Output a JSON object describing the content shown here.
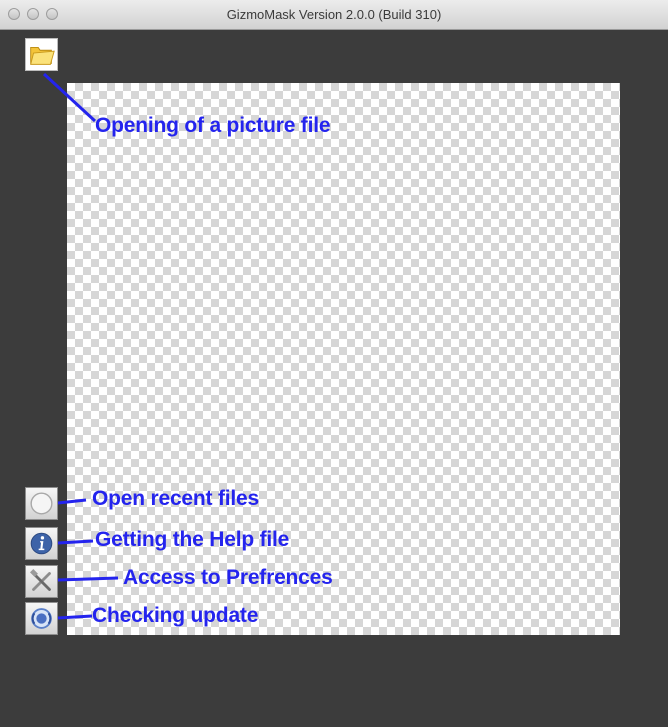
{
  "window": {
    "title": "GizmoMask Version 2.0.0 (Build 310)"
  },
  "toolbar": {
    "items": [
      {
        "id": "open",
        "icon": "folder-icon"
      },
      {
        "id": "recent",
        "icon": "clock-icon"
      },
      {
        "id": "help",
        "icon": "info-icon"
      },
      {
        "id": "preferences",
        "icon": "tools-icon"
      },
      {
        "id": "update",
        "icon": "update-icon"
      }
    ]
  },
  "annotations": {
    "open": "Opening of a picture file",
    "recent": "Open recent files",
    "help": "Getting the Help file",
    "preferences": "Access to Prefrences",
    "update": "Checking update"
  },
  "colors": {
    "annotation": "#2424ee",
    "background": "#3c3c3c"
  }
}
